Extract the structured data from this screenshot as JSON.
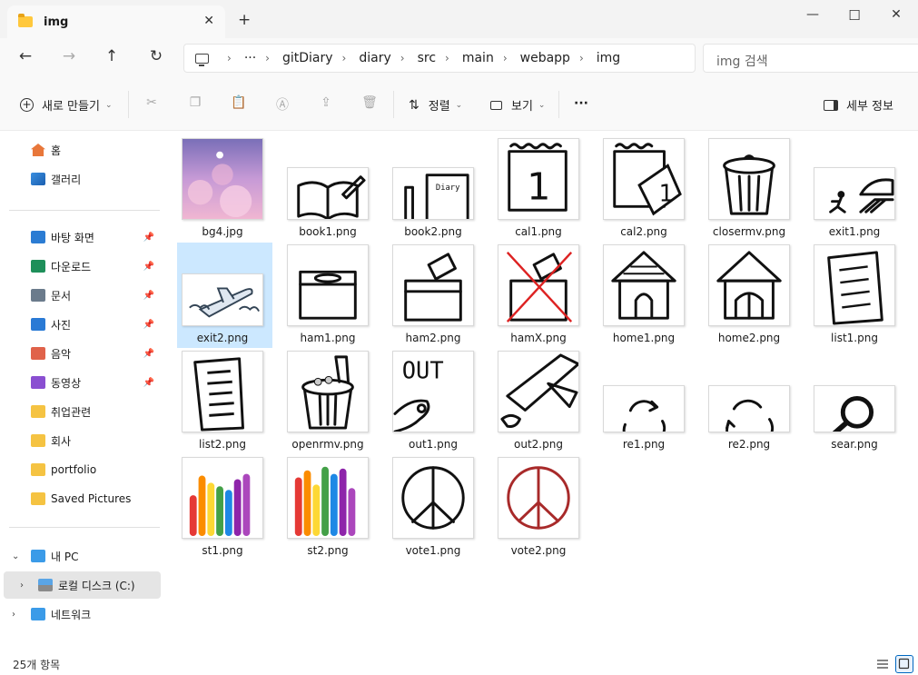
{
  "window": {
    "tab_title": "img",
    "tab_close": "✕",
    "new_tab": "+",
    "minimize": "—",
    "maximize": "☐",
    "close": "✕"
  },
  "nav": {
    "back": "←",
    "forward": "→",
    "up": "↑",
    "refresh": "↻"
  },
  "address": {
    "more": "···",
    "segments": [
      "gitDiary",
      "diary",
      "src",
      "main",
      "webapp",
      "img"
    ],
    "separator": "›"
  },
  "search": {
    "placeholder": "img 검색"
  },
  "toolbar": {
    "new_label": "새로 만들기",
    "sort_label": "정렬",
    "view_label": "보기",
    "more": "···",
    "details_label": "세부 정보"
  },
  "sidebar": {
    "home": "홈",
    "gallery": "갤러리",
    "pinned": [
      {
        "label": "바탕 화면",
        "icon": "desktop-icon",
        "color": "#2b7cd3"
      },
      {
        "label": "다운로드",
        "icon": "download-icon",
        "color": "#1e8f5a"
      },
      {
        "label": "문서",
        "icon": "document-icon",
        "color": "#6b7b8c"
      },
      {
        "label": "사진",
        "icon": "pictures-icon",
        "color": "#2a7ad5"
      },
      {
        "label": "음악",
        "icon": "music-icon",
        "color": "#e0624a"
      },
      {
        "label": "동영상",
        "icon": "video-icon",
        "color": "#8a4fd1"
      }
    ],
    "folders": [
      "취업관련",
      "회사",
      "portfolio",
      "Saved Pictures"
    ],
    "this_pc": "내 PC",
    "local_disk": "로컬 디스크 (C:)",
    "network": "네트워크"
  },
  "files": [
    {
      "name": "bg4.jpg",
      "kind": "sky"
    },
    {
      "name": "book1.png",
      "kind": "book1"
    },
    {
      "name": "book2.png",
      "kind": "book2"
    },
    {
      "name": "cal1.png",
      "kind": "cal1"
    },
    {
      "name": "cal2.png",
      "kind": "cal2"
    },
    {
      "name": "closermv.png",
      "kind": "bin"
    },
    {
      "name": "exit1.png",
      "kind": "exit1"
    },
    {
      "name": "exit2.png",
      "kind": "plane",
      "selected": true
    },
    {
      "name": "ham1.png",
      "kind": "box"
    },
    {
      "name": "ham2.png",
      "kind": "box2"
    },
    {
      "name": "hamX.png",
      "kind": "boxx"
    },
    {
      "name": "home1.png",
      "kind": "house"
    },
    {
      "name": "home2.png",
      "kind": "house2"
    },
    {
      "name": "list1.png",
      "kind": "list1"
    },
    {
      "name": "list2.png",
      "kind": "list2"
    },
    {
      "name": "openrmv.png",
      "kind": "openbin"
    },
    {
      "name": "out1.png",
      "kind": "out1"
    },
    {
      "name": "out2.png",
      "kind": "out2"
    },
    {
      "name": "re1.png",
      "kind": "re1"
    },
    {
      "name": "re2.png",
      "kind": "re2"
    },
    {
      "name": "sear.png",
      "kind": "sear"
    },
    {
      "name": "st1.png",
      "kind": "st1"
    },
    {
      "name": "st2.png",
      "kind": "st2"
    },
    {
      "name": "vote1.png",
      "kind": "vote1"
    },
    {
      "name": "vote2.png",
      "kind": "vote2"
    }
  ],
  "status": {
    "count": "25개 항목"
  },
  "out_text": "OUT",
  "cal_number": "1"
}
